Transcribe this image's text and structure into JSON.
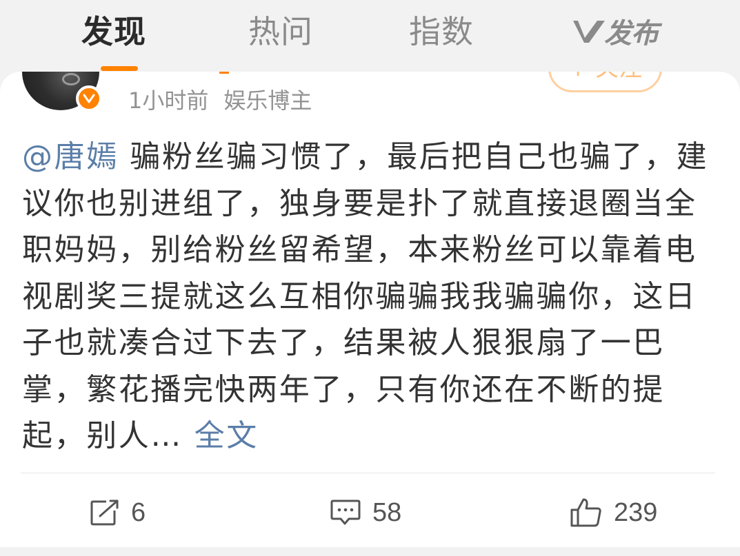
{
  "nav": {
    "tabs": [
      {
        "label": "发现",
        "active": true
      },
      {
        "label": "热问",
        "active": false
      },
      {
        "label": "指数",
        "active": false
      }
    ],
    "publish_label": "发布",
    "accent_color": "#ff8200"
  },
  "post": {
    "follow_label": "+ 关注",
    "time": "1小时前",
    "author_role": "娱乐博主",
    "mention": "@唐嫣",
    "text": "骗粉丝骗习惯了，最后把自己也骗了，建议你也别进组了，独身要是扑了就直接退圈当全职妈妈，别给粉丝留希望，本来粉丝可以靠着电视剧奖三提就这么互相你骗骗我我骗骗你，这日子也就凑合过下去了，结果被人狠狠扇了一巴掌，繁花播完快两年了，只有你还在不断的提起，别人…",
    "full_text_label": "全文",
    "link_color": "#5b7ea8"
  },
  "actions": {
    "repost_count": "6",
    "comment_count": "58",
    "like_count": "239"
  },
  "icons": {
    "publish": "weibo-v-icon",
    "verified": "verified-badge-icon",
    "repost": "repost-icon",
    "comment": "comment-icon",
    "like": "thumbs-up-icon"
  }
}
